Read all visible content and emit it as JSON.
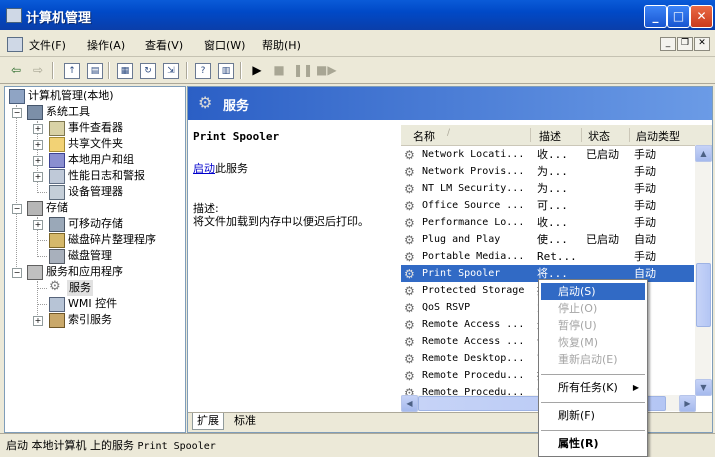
{
  "window": {
    "title": "计算机管理"
  },
  "menu": [
    "文件(F)",
    "操作(A)",
    "查看(V)",
    "窗口(W)",
    "帮助(H)"
  ],
  "tree": {
    "root": "计算机管理(本地)",
    "system_tools": "系统工具",
    "event_viewer": "事件查看器",
    "shared_folders": "共享文件夹",
    "local_users": "本地用户和组",
    "perf_logs": "性能日志和警报",
    "device_manager": "设备管理器",
    "storage": "存储",
    "removable": "可移动存储",
    "defrag": "磁盘碎片整理程序",
    "disk_mgmt": "磁盘管理",
    "services_apps": "服务和应用程序",
    "services": "服务",
    "wmi": "WMI 控件",
    "indexing": "索引服务"
  },
  "services_header": {
    "title": "服务"
  },
  "extended": {
    "service_name": "Print Spooler",
    "start_link": "启动",
    "start_suffix": "此服务",
    "desc_label": "描述:",
    "desc_text": "将文件加载到内存中以便迟后打印。"
  },
  "columns": {
    "name": "名称",
    "desc": "描述",
    "status": "状态",
    "startup": "启动类型"
  },
  "rows": [
    {
      "name": "Network Locati...",
      "desc": "收...",
      "status": "已启动",
      "startup": "手动"
    },
    {
      "name": "Network Provis...",
      "desc": "为...",
      "status": "",
      "startup": "手动"
    },
    {
      "name": "NT LM Security...",
      "desc": "为...",
      "status": "",
      "startup": "手动"
    },
    {
      "name": "Office Source ...",
      "desc": "可...",
      "status": "",
      "startup": "手动"
    },
    {
      "name": "Performance Lo...",
      "desc": "收...",
      "status": "",
      "startup": "手动"
    },
    {
      "name": "Plug and Play",
      "desc": "使...",
      "status": "已启动",
      "startup": "自动"
    },
    {
      "name": "Portable Media...",
      "desc": "Ret...",
      "status": "",
      "startup": "手动"
    },
    {
      "name": "Print Spooler",
      "desc": "将...",
      "status": "",
      "startup": "自动"
    },
    {
      "name": "Protected Storage",
      "desc": "提",
      "status": "",
      "startup": "动"
    },
    {
      "name": "QoS RSVP",
      "desc": "为",
      "status": "",
      "startup": "动"
    },
    {
      "name": "Remote Access ...",
      "desc": "无",
      "status": "",
      "startup": "动"
    },
    {
      "name": "Remote Access ...",
      "desc": "创",
      "status": "",
      "startup": "动"
    },
    {
      "name": "Remote Desktop...",
      "desc": "管",
      "status": "",
      "startup": "动"
    },
    {
      "name": "Remote Procedu...",
      "desc": "提",
      "status": "",
      "startup": "动"
    },
    {
      "name": "Remote Procedu...",
      "desc": "管",
      "status": "",
      "startup": "动"
    }
  ],
  "tabs": [
    "扩展",
    "标准"
  ],
  "status_bar": {
    "prefix": "启动 本地计算机 上的服务 ",
    "service": "Print Spooler"
  },
  "context_menu": {
    "start": "启动(S)",
    "stop": "停止(O)",
    "pause": "暂停(U)",
    "resume": "恢复(M)",
    "restart": "重新启动(E)",
    "all_tasks": "所有任务(K)",
    "refresh": "刷新(F)",
    "properties": "属性(R)"
  }
}
